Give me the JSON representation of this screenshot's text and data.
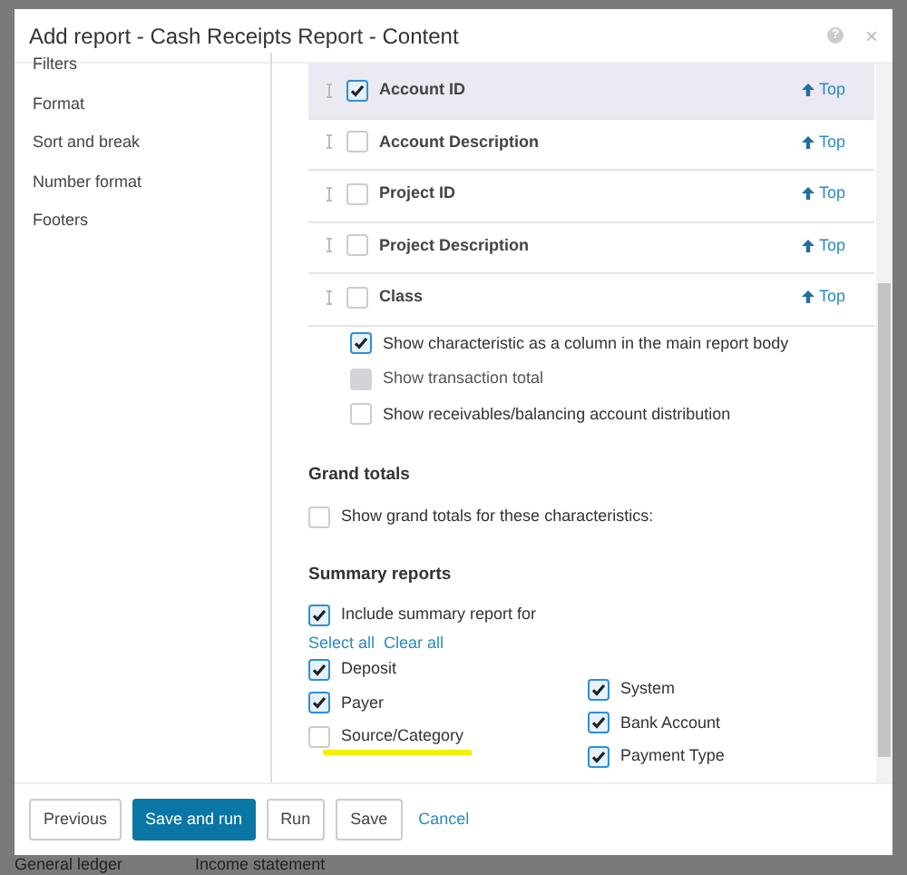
{
  "background": {
    "texts": [
      "General ledger",
      "Income statement"
    ]
  },
  "window": {
    "title": "Add report - Cash Receipts Report - Content",
    "help": "?",
    "close": "×"
  },
  "sidebar": {
    "items": [
      {
        "label": "Filters",
        "selected": false
      },
      {
        "label": "Format",
        "selected": false
      },
      {
        "label": "Sort and break",
        "selected": false
      },
      {
        "label": "Number format",
        "selected": false
      },
      {
        "label": "Footers",
        "selected": false
      }
    ]
  },
  "characteristics": [
    {
      "label": "Account ID",
      "checked": true,
      "selected": true,
      "top": "Top"
    },
    {
      "label": "Account Description",
      "checked": false,
      "selected": false,
      "top": "Top"
    },
    {
      "label": "Project ID",
      "checked": false,
      "selected": false,
      "top": "Top"
    },
    {
      "label": "Project Description",
      "checked": false,
      "selected": false,
      "top": "Top"
    },
    {
      "label": "Class",
      "checked": false,
      "selected": false,
      "top": "Top"
    }
  ],
  "options": [
    {
      "label": "Show characteristic as a column in the main report body",
      "checked": true,
      "disabled": false
    },
    {
      "label": "Show transaction total",
      "checked": false,
      "disabled": true
    },
    {
      "label": "Show receivables/balancing account distribution",
      "checked": false,
      "disabled": false
    }
  ],
  "grand_totals": {
    "heading": "Grand totals",
    "label": "Show grand totals for these characteristics:",
    "checked": false
  },
  "summary_reports": {
    "heading": "Summary reports",
    "include": {
      "label": "Include summary report for",
      "checked": true
    },
    "select_all": "Select all",
    "clear_all": "Clear all",
    "left": [
      {
        "label": "Deposit",
        "checked": true,
        "highlighted": false
      },
      {
        "label": "Payer",
        "checked": true,
        "highlighted": false
      },
      {
        "label": "Source/Category",
        "checked": false,
        "highlighted": true
      }
    ],
    "right": [
      {
        "label": "System",
        "checked": true
      },
      {
        "label": "Bank Account",
        "checked": true
      },
      {
        "label": "Payment Type",
        "checked": true
      }
    ]
  },
  "buttons": [
    {
      "label": "Previous",
      "kind": "default"
    },
    {
      "label": "Save and run",
      "kind": "primary"
    },
    {
      "label": "Run",
      "kind": "default"
    },
    {
      "label": "Save",
      "kind": "default"
    },
    {
      "label": "Cancel",
      "kind": "link"
    }
  ]
}
